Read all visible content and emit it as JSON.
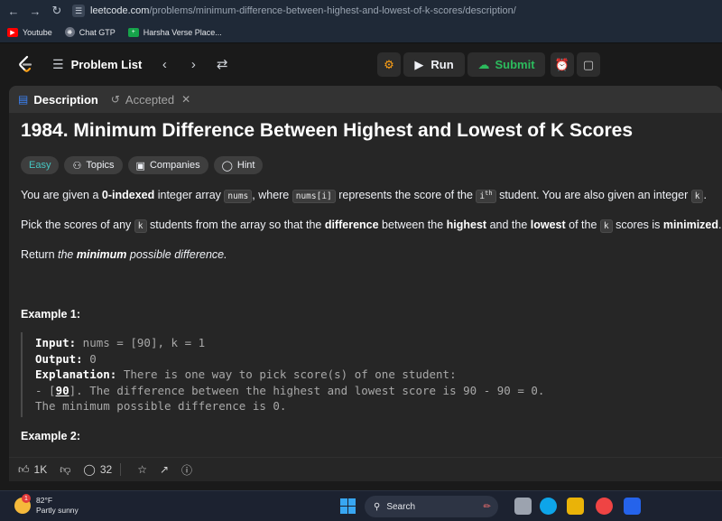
{
  "browser": {
    "url_domain": "leetcode.com",
    "url_path": "/problems/minimum-difference-between-highest-and-lowest-of-k-scores/description/",
    "bookmarks": [
      {
        "label": "Youtube",
        "icon": "youtube-icon",
        "color": "#ff0000"
      },
      {
        "label": "Chat GTP",
        "icon": "chatgpt-icon",
        "color": "#9ca3af"
      },
      {
        "label": "Harsha Verse Place...",
        "icon": "plus-icon",
        "color": "#22c55e"
      }
    ]
  },
  "header": {
    "problem_list": "Problem List",
    "run": "Run",
    "submit": "Submit"
  },
  "tabs": {
    "description": "Description",
    "accepted": "Accepted"
  },
  "problem": {
    "title": "1984. Minimum Difference Between Highest and Lowest of K Scores",
    "difficulty": "Easy",
    "tags": {
      "topics": "Topics",
      "companies": "Companies",
      "hint": "Hint"
    },
    "p1": {
      "a": "You are given a ",
      "b": "0-indexed",
      "c": " integer array ",
      "d": "nums",
      "e": ", where ",
      "f": "nums[i]",
      "g": " represents the score of the ",
      "h": "i",
      "hs": "th",
      "i": " student. You are also given an integer ",
      "j": "k",
      "k": "."
    },
    "p2": {
      "a": "Pick the scores of any ",
      "b": "k",
      "c": " students from the array so that the ",
      "d": "difference",
      "e": " between the ",
      "f": "highest",
      "g": " and the ",
      "h": "lowest",
      "i": " of the ",
      "j": "k",
      "k": " scores is ",
      "l": "minimized",
      "m": "."
    },
    "p3": {
      "a": "Return ",
      "b": "the ",
      "c": "minimum",
      "d": " possible difference."
    },
    "example1": {
      "heading": "Example 1:",
      "input_label": "Input:",
      "input": " nums = [90], k = 1",
      "output_label": "Output:",
      "output": " 0",
      "expl_label": "Explanation:",
      "expl": " There is one way to pick score(s) of one student:",
      "line4_a": "- [",
      "line4_b": "90",
      "line4_c": "]. The difference between the highest and lowest score is 90 - 90 = 0.",
      "line5": "The minimum possible difference is 0."
    },
    "example2": {
      "heading": "Example 2:"
    }
  },
  "footer": {
    "likes": "1K",
    "comments": "32"
  },
  "taskbar": {
    "temp": "82°F",
    "weather": "Partly sunny",
    "notif": "1",
    "search": "Search"
  }
}
